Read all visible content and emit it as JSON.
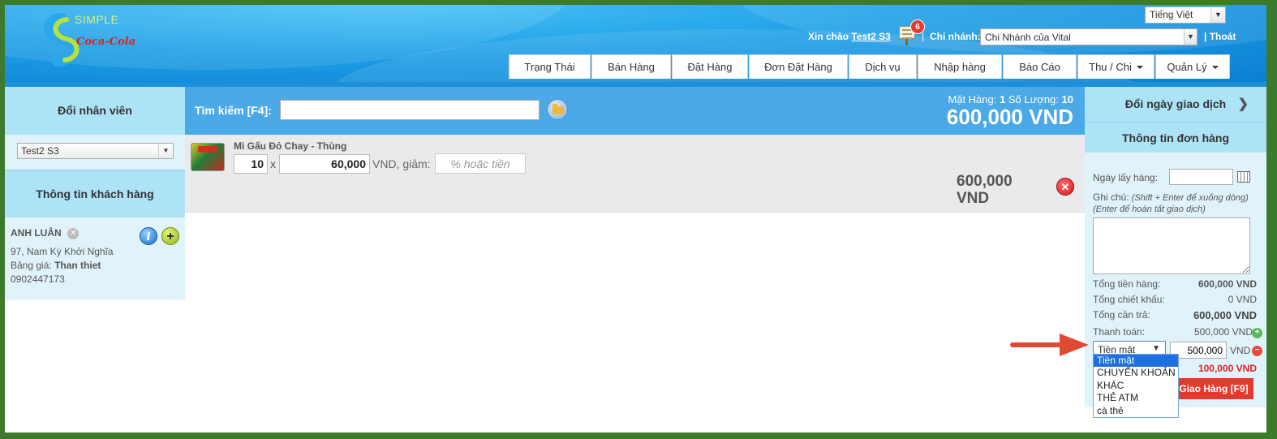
{
  "header": {
    "logo_text": "SIMPLE",
    "brand_text": "Coca-Cola",
    "language": "Tiếng Việt",
    "greeting_prefix": "Xin chào",
    "user": "Test2 S3",
    "notifications": "6",
    "separator": "|",
    "branch_label": "Chi nhánh:",
    "branch": "Chi Nhánh của Vital",
    "logout": "| Thoát",
    "nav": [
      {
        "label": "Trạng Thái"
      },
      {
        "label": "Bán Hàng"
      },
      {
        "label": "Đặt Hàng"
      },
      {
        "label": "Đơn Đặt Hàng"
      },
      {
        "label": "Dịch vụ"
      },
      {
        "label": "Nhập hàng"
      },
      {
        "label": "Báo Cáo"
      },
      {
        "label": "Thu / Chi"
      },
      {
        "label": "Quản Lý"
      }
    ],
    "active_tab": "Đặt Hàng"
  },
  "left": {
    "staff_title": "Đổi nhân viên",
    "staff_selected": "Test2 S3",
    "customer_title": "Thông tin khách hàng",
    "customer": {
      "name": "ANH LUÂN",
      "address": "97, Nam Kỳ Khởi Nghĩa",
      "price_label": "Bảng giá:",
      "price_list": "Than thiet",
      "phone": "0902447173"
    }
  },
  "center": {
    "search_label": "Tìm kiếm [F4]:",
    "search_value": "",
    "summary_items_label": "Mặt Hàng:",
    "summary_items": "1",
    "summary_qty_label": "Số Lượng:",
    "summary_qty": "10",
    "summary_total": "600,000 VND",
    "items": [
      {
        "name": "Mì Gấu Đỏ Chay - Thùng",
        "qty": "10",
        "times": "x",
        "price": "60,000",
        "vnd_discount": "VND, giảm:",
        "discount_placeholder": "% hoặc tiền",
        "total_line1": "600,000",
        "total_line2": "VND"
      }
    ]
  },
  "right": {
    "change_date": "Đổi ngày giao dịch",
    "order_info": "Thông tin đơn hàng",
    "pickup_label": "Ngày lấy hàng:",
    "pickup_value": "",
    "note_label": "Ghi chú:",
    "note_hint1": "(Shift + Enter để xuống dòng)",
    "note_hint2": "(Enter để hoàn tất giao dịch)",
    "note_value": "",
    "subtotal_label": "Tổng tiền hàng:",
    "subtotal": "600,000 VND",
    "discount_label": "Tổng chiết khấu:",
    "discount": "0 VND",
    "due_label": "Tổng cần trả:",
    "due": "600,000 VND",
    "paid_label": "Thanh toán:",
    "paid": "500,000 VND",
    "pay_method": "Tiền mặt",
    "pay_amount": "500,000",
    "pay_unit": "VND",
    "remaining": "100,000 VND",
    "deliver_button": "Giao Hàng [F9]",
    "pay_options": [
      "Tiền mặt",
      "CHUYỂN KHOẢN",
      "KHÁC",
      "THẺ ATM",
      "cà thẻ"
    ]
  },
  "colors": {
    "nav_blue": "#1b8fd8",
    "panel_light": "#ade3f7",
    "panel_bg": "#e1f3fa",
    "search_bar": "#4aa9e6",
    "danger": "#e23a2c"
  }
}
